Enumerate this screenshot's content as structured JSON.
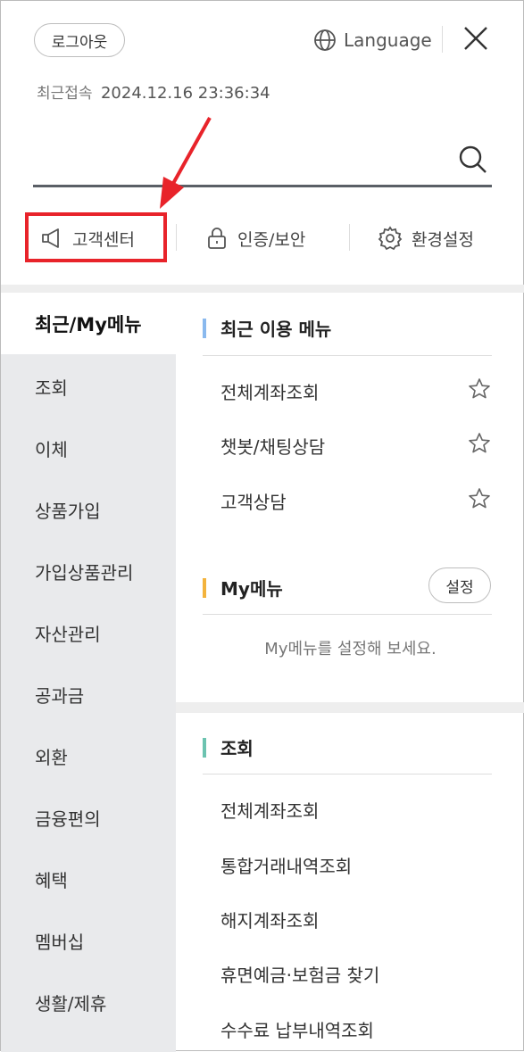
{
  "header": {
    "logout_label": "로그아웃",
    "language_label": "Language",
    "last_login_label": "최근접속",
    "last_login_time": "2024.12.16 23:36:34"
  },
  "search": {
    "value": "",
    "placeholder": ""
  },
  "quick_menu": [
    {
      "label": "고객센터",
      "icon": "megaphone-icon"
    },
    {
      "label": "인증/보안",
      "icon": "lock-icon"
    },
    {
      "label": "환경설정",
      "icon": "gear-icon"
    }
  ],
  "left_nav": [
    "최근/My메뉴",
    "조회",
    "이체",
    "상품가입",
    "가입상품관리",
    "자산관리",
    "공과금",
    "외환",
    "금융편의",
    "혜택",
    "멤버십",
    "생활/제휴"
  ],
  "recent_section": {
    "title": "최근 이용 메뉴",
    "bar_color": "#8ab9ee",
    "items": [
      "전체계좌조회",
      "챗봇/채팅상담",
      "고객상담"
    ]
  },
  "my_section": {
    "title": "My메뉴",
    "bar_color": "#f3b33d",
    "settings_label": "설정",
    "empty_text": "My메뉴를 설정해 보세요."
  },
  "inquiry_section": {
    "title": "조회",
    "bar_color": "#6cc3b0",
    "items": [
      "전체계좌조회",
      "통합거래내역조회",
      "해지계좌조회",
      "휴면예금·보험금 찾기",
      "수수료 납부내역조회"
    ]
  },
  "colors": {
    "highlight": "#e8232a",
    "arrow": "#e8232a"
  }
}
